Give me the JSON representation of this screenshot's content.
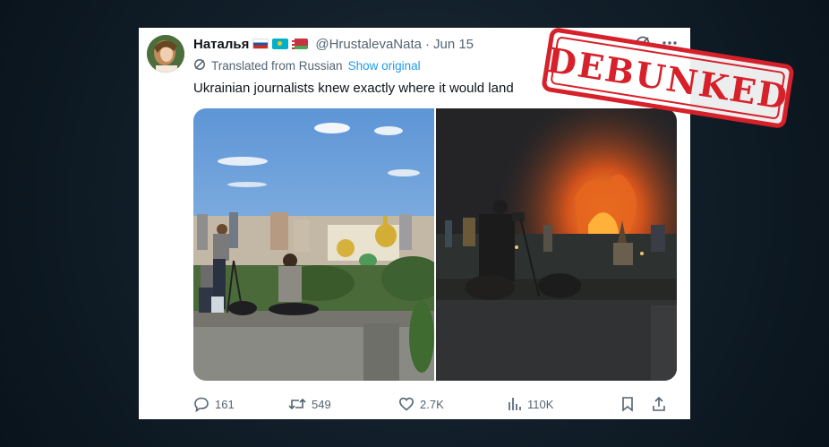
{
  "tweet": {
    "display_name": "Наталья",
    "flags": [
      "russia-flag",
      "kazakhstan-flag",
      "belarus-flag"
    ],
    "handle": "@HrustalevaNata",
    "separator": "·",
    "date": "Jun 15",
    "translated_label": "Translated from Russian",
    "show_original": "Show original",
    "text": "Ukrainian journalists knew exactly where it would land",
    "icons": {
      "grok": "grok-icon",
      "more": "more-icon"
    }
  },
  "media": {
    "left_photo": "daytime-kyiv-rooftop-photo",
    "right_photo": "night-fire-rooftop-photo"
  },
  "actions": {
    "replies": "161",
    "reposts": "549",
    "likes": "2.7K",
    "views": "110K",
    "icons": [
      "reply-icon",
      "repost-icon",
      "like-icon",
      "views-icon",
      "bookmark-icon",
      "share-icon"
    ]
  },
  "stamp": {
    "text": "DEBUNKED",
    "color": "#d6202a"
  },
  "colors": {
    "accent": "#1d9bf0",
    "muted": "#536471",
    "text": "#0f1419"
  }
}
